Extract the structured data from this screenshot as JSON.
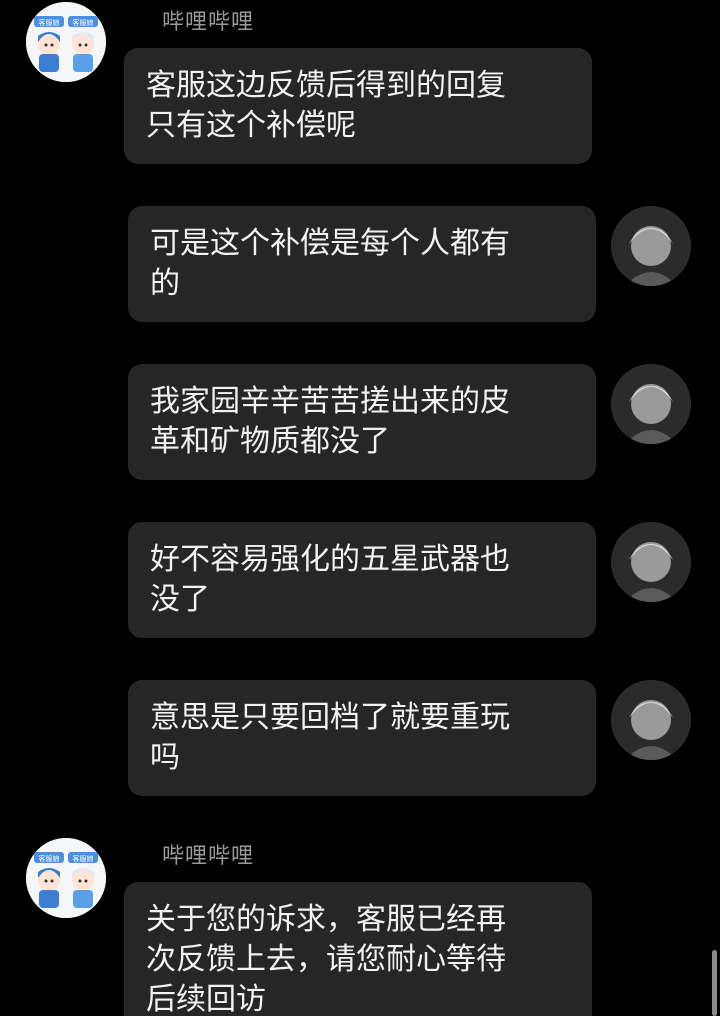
{
  "messages": [
    {
      "sender": "bilibili",
      "name": "哔哩哔哩",
      "text": "客服这边反馈后得到的回复\n只有这个补偿呢"
    },
    {
      "sender": "user",
      "text": "可是这个补偿是每个人都有\n的"
    },
    {
      "sender": "user",
      "text": "我家园辛辛苦苦搓出来的皮\n革和矿物质都没了"
    },
    {
      "sender": "user",
      "text": "好不容易强化的五星武器也\n没了"
    },
    {
      "sender": "user",
      "text": "意思是只要回档了就要重玩\n吗"
    },
    {
      "sender": "bilibili",
      "name": "哔哩哔哩",
      "text": "关于您的诉求，客服已经再\n次反馈上去，请您耐心等待\n后续回访"
    }
  ],
  "badge_text": "客服娘",
  "colors": {
    "background": "#000000",
    "bubble": "#262626",
    "text": "#f2f2f2",
    "name": "#9a9a9a"
  }
}
